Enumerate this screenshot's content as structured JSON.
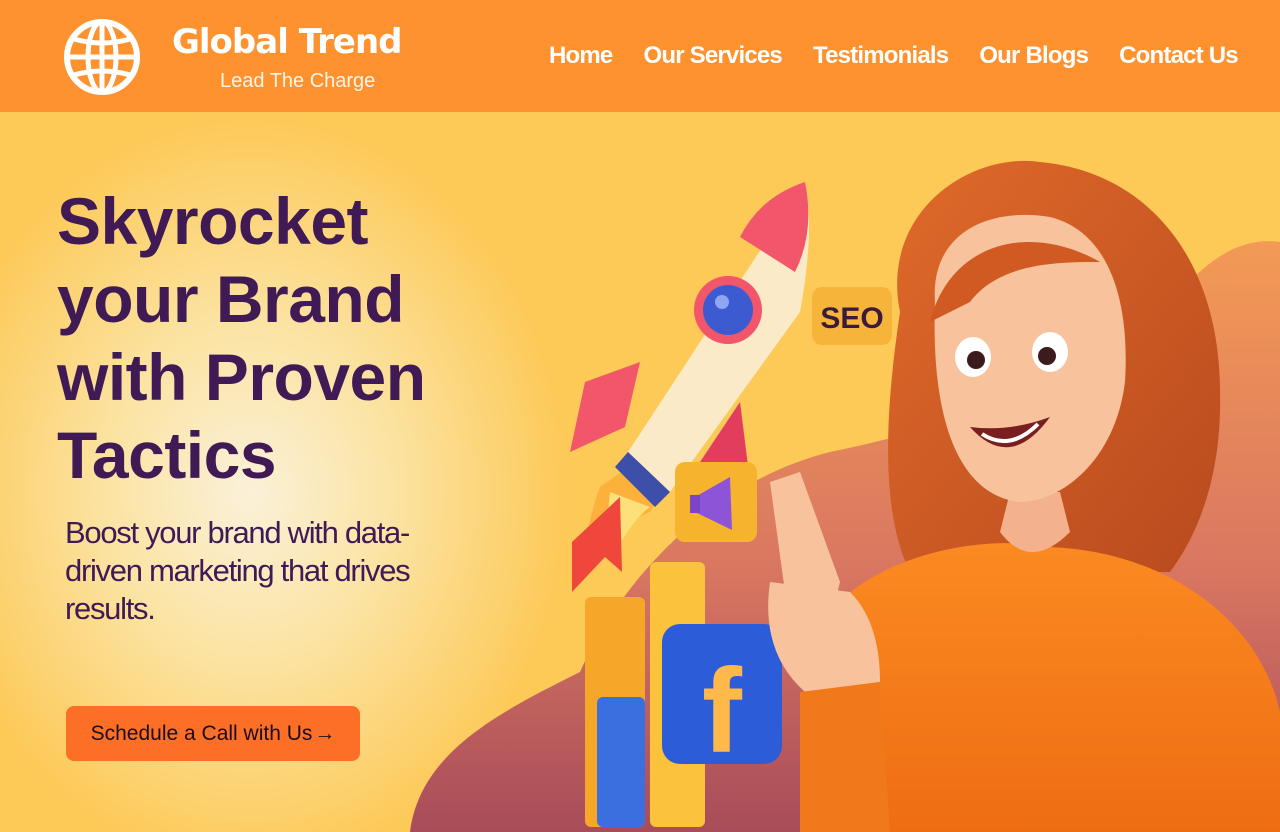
{
  "brand": {
    "name": "Global Trend",
    "tagline": "Lead The Charge",
    "logo_icon": "globe-icon"
  },
  "nav": {
    "items": [
      {
        "label": "Home"
      },
      {
        "label": "Our Services"
      },
      {
        "label": "Testimonials"
      },
      {
        "label": "Our Blogs"
      },
      {
        "label": "Contact Us"
      }
    ]
  },
  "hero": {
    "headline": "Skyrocket your Brand with Proven Tactics",
    "subtext": "Boost your brand with data-driven marketing that drives results.",
    "cta_label": "Schedule a Call with Us",
    "cta_arrow": "→",
    "illustration_badges": {
      "seo": "SEO",
      "facebook": "f"
    }
  },
  "colors": {
    "header_bg": "#fd922e",
    "hero_bg": "#fdc957",
    "headline": "#3f1a55",
    "cta_bg": "#fd6f26"
  }
}
